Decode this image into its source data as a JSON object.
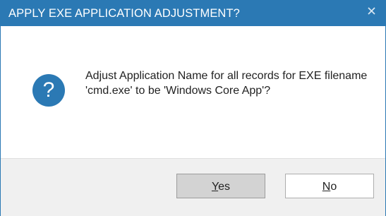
{
  "dialog": {
    "title": "APPLY EXE APPLICATION ADJUSTMENT?",
    "close_icon": "close-icon",
    "message_icon": "question-icon",
    "message": "Adjust Application Name for all records for EXE filename 'cmd.exe' to be 'Windows Core App'?",
    "buttons": {
      "yes": {
        "access_key": "Y",
        "rest": "es"
      },
      "no": {
        "access_key": "N",
        "rest": "o"
      }
    }
  },
  "colors": {
    "titlebar": "#2b79b4",
    "icon": "#2b79b4",
    "footer": "#f0f0f0",
    "default_button": "#d3d3d3"
  }
}
